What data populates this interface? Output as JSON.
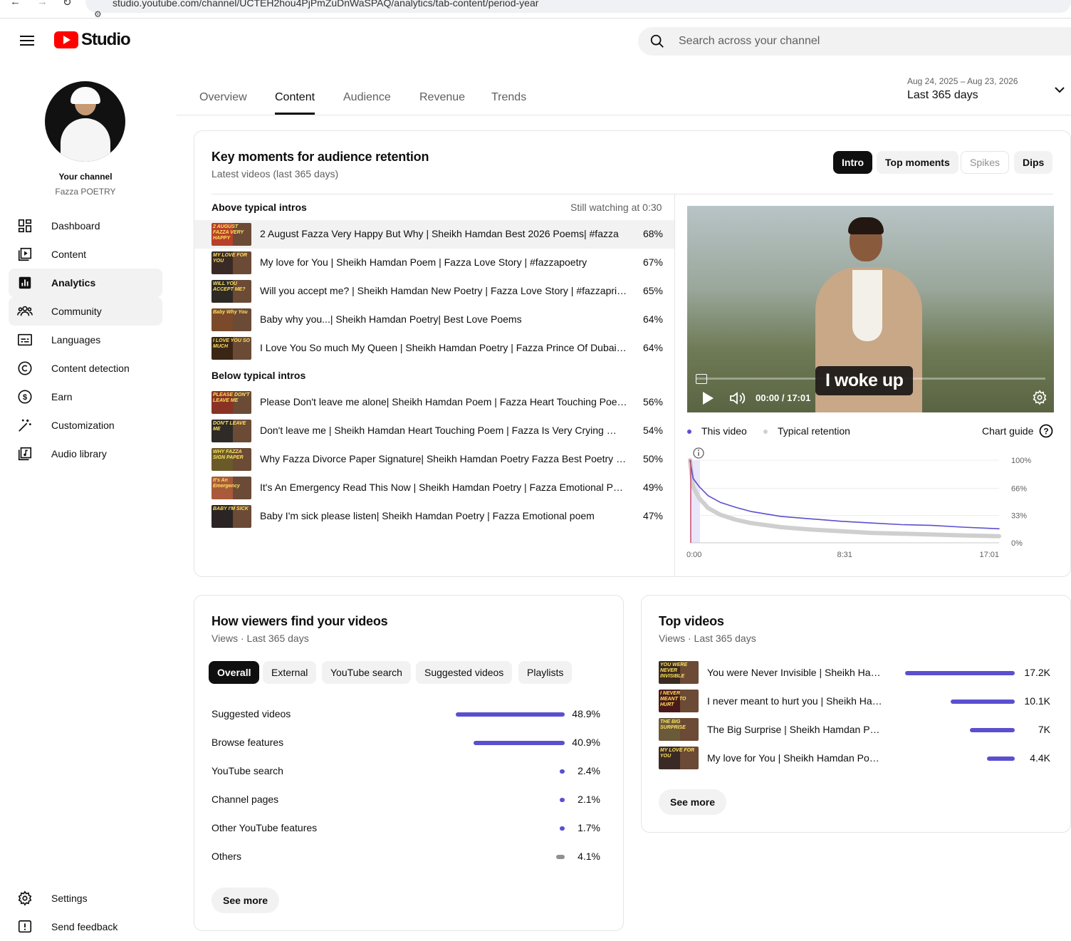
{
  "browser": {
    "url": "studio.youtube.com/channel/UCTEH2hou4PjPmZuDnWaSPAQ/analytics/tab-content/period-year"
  },
  "header": {
    "logo_text": "Studio",
    "search_placeholder": "Search across your channel"
  },
  "channel": {
    "title": "Your channel",
    "name": "Fazza POETRY"
  },
  "sidebar": {
    "items": [
      {
        "label": "Dashboard",
        "icon": "dashboard-icon"
      },
      {
        "label": "Content",
        "icon": "content-icon"
      },
      {
        "label": "Analytics",
        "icon": "analytics-icon"
      },
      {
        "label": "Community",
        "icon": "community-icon"
      },
      {
        "label": "Languages",
        "icon": "languages-icon"
      },
      {
        "label": "Content detection",
        "icon": "copyright-icon"
      },
      {
        "label": "Earn",
        "icon": "dollar-icon"
      },
      {
        "label": "Customization",
        "icon": "magic-wand-icon"
      },
      {
        "label": "Audio library",
        "icon": "audio-library-icon"
      }
    ],
    "bottom": [
      {
        "label": "Settings",
        "icon": "gear-icon"
      },
      {
        "label": "Send feedback",
        "icon": "feedback-icon"
      }
    ]
  },
  "tabs": [
    "Overview",
    "Content",
    "Audience",
    "Revenue",
    "Trends"
  ],
  "active_tab": "Content",
  "period": {
    "range": "Aug 24, 2025 – Aug 23, 2026",
    "label": "Last 365 days"
  },
  "key_moments": {
    "title": "Key moments for audience retention",
    "subtitle": "Latest videos (last 365 days)",
    "chips": [
      "Intro",
      "Top moments",
      "Spikes",
      "Dips"
    ],
    "above_label": "Above typical intros",
    "still_watching": "Still watching at 0:30",
    "above": [
      {
        "title": "2 August Fazza Very Happy But Why | Sheikh Hamdan Best 2026 Poems| #fazza",
        "pct": "68%",
        "thumb_text": "2 AUGUST FAZZA VERY HAPPY",
        "thumb_color": "#b7412a"
      },
      {
        "title": "My love for You | Sheikh Hamdan Poem | Fazza Love Story | #fazzapoetry",
        "pct": "67%",
        "thumb_text": "MY LOVE FOR YOU",
        "thumb_color": "#3a2a26"
      },
      {
        "title": "Will you accept me? | Sheikh Hamdan New Poetry | Fazza Love Story | #fazzaprin…",
        "pct": "65%",
        "thumb_text": "WILL YOU ACCEPT ME?",
        "thumb_color": "#2d2a26"
      },
      {
        "title": "Baby why you...| Sheikh Hamdan Poetry| Best Love Poems",
        "pct": "64%",
        "thumb_text": "Baby Why You",
        "thumb_color": "#7a4a2a"
      },
      {
        "title": "I Love You So much My Queen | Sheikh Hamdan Poetry | Fazza Prince Of Dubai | …",
        "pct": "64%",
        "thumb_text": "I LOVE YOU SO MUCH",
        "thumb_color": "#3b2616"
      }
    ],
    "below_label": "Below typical intros",
    "below": [
      {
        "title": "Please Don't leave me alone| Sheikh Hamdan Poem | Fazza Heart Touching Poetr…",
        "pct": "56%",
        "thumb_text": "PLEASE DON'T LEAVE ME",
        "thumb_color": "#8a3324"
      },
      {
        "title": "Don't leave me | Sheikh Hamdan Heart Touching Poem | Fazza Is Very Crying 😭 …",
        "pct": "54%",
        "thumb_text": "DON'T LEAVE ME",
        "thumb_color": "#2d2a28"
      },
      {
        "title": "Why Fazza Divorce Paper Signature| Sheikh Hamdan Poetry Fazza Best Poetry |#f…",
        "pct": "50%",
        "thumb_text": "WHY FAZZA SIGN PAPER",
        "thumb_color": "#6a5a2a"
      },
      {
        "title": "It's An Emergency Read This Now | Sheikh Hamdan Poetry | Fazza Emotional Poe…",
        "pct": "49%",
        "thumb_text": "It's An Emergency",
        "thumb_color": "#a85a3a"
      },
      {
        "title": "Baby I'm sick please listen| Sheikh Hamdan Poetry | Fazza Emotional poem",
        "pct": "47%",
        "thumb_text": "BABY I'M SICK",
        "thumb_color": "#2a2424"
      }
    ],
    "player": {
      "caption": "I woke up",
      "time": "00:00 / 17:01"
    },
    "legend": {
      "this_video": "This video",
      "typical": "Typical retention",
      "chart_guide": "Chart guide"
    }
  },
  "chart_data": {
    "type": "line",
    "x_ticks": [
      "0:00",
      "8:31",
      "17:01"
    ],
    "y_ticks": [
      "100%",
      "66%",
      "33%",
      "0%"
    ],
    "ylim": [
      0,
      100
    ],
    "xlim": [
      0,
      1021
    ],
    "series": [
      {
        "name": "This video",
        "color": "#5b4fcf",
        "x": [
          0,
          10,
          30,
          60,
          100,
          150,
          200,
          300,
          400,
          500,
          600,
          700,
          800,
          900,
          1021
        ],
        "y": [
          100,
          78,
          68,
          57,
          49,
          43,
          38,
          32,
          29,
          26,
          24,
          22,
          21,
          19,
          17
        ]
      },
      {
        "name": "Typical retention",
        "color": "#cfcfcf",
        "x": [
          0,
          10,
          30,
          60,
          100,
          150,
          200,
          300,
          400,
          500,
          600,
          700,
          800,
          900,
          1021
        ],
        "y": [
          100,
          68,
          54,
          42,
          34,
          28,
          24,
          19,
          16,
          14,
          12,
          11,
          10,
          9,
          8
        ]
      }
    ]
  },
  "traffic": {
    "title": "How viewers find your videos",
    "subtitle": "Views · Last 365 days",
    "chips": [
      "Overall",
      "External",
      "YouTube search",
      "Suggested videos",
      "Playlists"
    ],
    "rows": [
      {
        "label": "Suggested videos",
        "value": "48.9%",
        "share": 48.9
      },
      {
        "label": "Browse features",
        "value": "40.9%",
        "share": 40.9
      },
      {
        "label": "YouTube search",
        "value": "2.4%",
        "share": 2.4
      },
      {
        "label": "Channel pages",
        "value": "2.1%",
        "share": 2.1
      },
      {
        "label": "Other YouTube features",
        "value": "1.7%",
        "share": 1.7
      },
      {
        "label": "Others",
        "value": "4.1%",
        "share": 4.1,
        "gray": true
      }
    ],
    "see_more": "See more"
  },
  "top_videos": {
    "title": "Top videos",
    "subtitle": "Views · Last 365 days",
    "rows": [
      {
        "title": "You were Never Invisible | Sheikh Ha…",
        "value": "17.2K",
        "views": 17200,
        "thumb_text": "YOU WERE NEVER INVISIBLE",
        "thumb_color": "#3a2a1f"
      },
      {
        "title": "I never meant to hurt you | Sheikh Ha…",
        "value": "10.1K",
        "views": 10100,
        "thumb_text": "I NEVER MEANT TO HURT",
        "thumb_color": "#4a1a1a"
      },
      {
        "title": "The Big Surprise | Sheikh Hamdan Po…",
        "value": "7K",
        "views": 7000,
        "thumb_text": "THE BIG SURPRISE",
        "thumb_color": "#6a5a3a"
      },
      {
        "title": "My love for You | Sheikh Hamdan Poe…",
        "value": "4.4K",
        "views": 4400,
        "thumb_text": "MY LOVE FOR YOU",
        "thumb_color": "#3a2a26"
      }
    ],
    "see_more": "See more"
  }
}
